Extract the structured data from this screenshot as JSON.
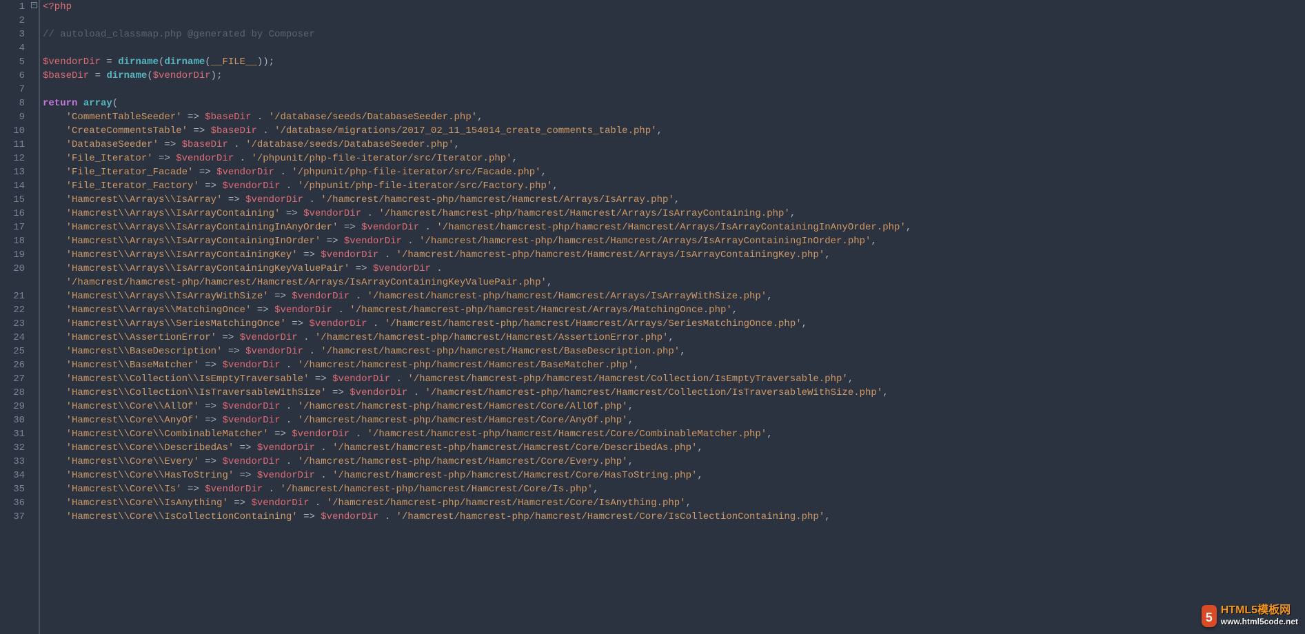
{
  "fold_marker": "−",
  "watermark": {
    "badge": "5",
    "line1": "HTML5模板网",
    "line2": "www.html5code.net"
  },
  "lines": [
    {
      "n": 1,
      "seg": [
        [
          "tag",
          "<?php"
        ]
      ]
    },
    {
      "n": 2,
      "seg": []
    },
    {
      "n": 3,
      "seg": [
        [
          "comment",
          "// autoload_classmap.php @generated by Composer"
        ]
      ]
    },
    {
      "n": 4,
      "seg": []
    },
    {
      "n": 5,
      "seg": [
        [
          "var",
          "$vendorDir"
        ],
        [
          "op",
          " = "
        ],
        [
          "func",
          "dirname"
        ],
        [
          "punct",
          "("
        ],
        [
          "func",
          "dirname"
        ],
        [
          "punct",
          "("
        ],
        [
          "const",
          "__FILE__"
        ],
        [
          "punct",
          "));"
        ]
      ]
    },
    {
      "n": 6,
      "seg": [
        [
          "var",
          "$baseDir"
        ],
        [
          "op",
          " = "
        ],
        [
          "func",
          "dirname"
        ],
        [
          "punct",
          "("
        ],
        [
          "var",
          "$vendorDir"
        ],
        [
          "punct",
          ");"
        ]
      ]
    },
    {
      "n": 7,
      "seg": []
    },
    {
      "n": 8,
      "seg": [
        [
          "kw",
          "return"
        ],
        [
          "op",
          " "
        ],
        [
          "func",
          "array"
        ],
        [
          "punct",
          "("
        ]
      ]
    },
    {
      "n": 9,
      "seg": [
        [
          "punct",
          "    "
        ],
        [
          "str",
          "'CommentTableSeeder'"
        ],
        [
          "op",
          " => "
        ],
        [
          "var",
          "$baseDir"
        ],
        [
          "op",
          " . "
        ],
        [
          "str",
          "'/database/seeds/DatabaseSeeder.php'"
        ],
        [
          "punct",
          ","
        ]
      ]
    },
    {
      "n": 10,
      "seg": [
        [
          "punct",
          "    "
        ],
        [
          "str",
          "'CreateCommentsTable'"
        ],
        [
          "op",
          " => "
        ],
        [
          "var",
          "$baseDir"
        ],
        [
          "op",
          " . "
        ],
        [
          "str",
          "'/database/migrations/2017_02_11_154014_create_comments_table.php'"
        ],
        [
          "punct",
          ","
        ]
      ]
    },
    {
      "n": 11,
      "seg": [
        [
          "punct",
          "    "
        ],
        [
          "str",
          "'DatabaseSeeder'"
        ],
        [
          "op",
          " => "
        ],
        [
          "var",
          "$baseDir"
        ],
        [
          "op",
          " . "
        ],
        [
          "str",
          "'/database/seeds/DatabaseSeeder.php'"
        ],
        [
          "punct",
          ","
        ]
      ]
    },
    {
      "n": 12,
      "seg": [
        [
          "punct",
          "    "
        ],
        [
          "str",
          "'File_Iterator'"
        ],
        [
          "op",
          " => "
        ],
        [
          "var",
          "$vendorDir"
        ],
        [
          "op",
          " . "
        ],
        [
          "str",
          "'/phpunit/php-file-iterator/src/Iterator.php'"
        ],
        [
          "punct",
          ","
        ]
      ]
    },
    {
      "n": 13,
      "seg": [
        [
          "punct",
          "    "
        ],
        [
          "str",
          "'File_Iterator_Facade'"
        ],
        [
          "op",
          " => "
        ],
        [
          "var",
          "$vendorDir"
        ],
        [
          "op",
          " . "
        ],
        [
          "str",
          "'/phpunit/php-file-iterator/src/Facade.php'"
        ],
        [
          "punct",
          ","
        ]
      ]
    },
    {
      "n": 14,
      "seg": [
        [
          "punct",
          "    "
        ],
        [
          "str",
          "'File_Iterator_Factory'"
        ],
        [
          "op",
          " => "
        ],
        [
          "var",
          "$vendorDir"
        ],
        [
          "op",
          " . "
        ],
        [
          "str",
          "'/phpunit/php-file-iterator/src/Factory.php'"
        ],
        [
          "punct",
          ","
        ]
      ]
    },
    {
      "n": 15,
      "seg": [
        [
          "punct",
          "    "
        ],
        [
          "str",
          "'Hamcrest\\\\Arrays\\\\IsArray'"
        ],
        [
          "op",
          " => "
        ],
        [
          "var",
          "$vendorDir"
        ],
        [
          "op",
          " . "
        ],
        [
          "str",
          "'/hamcrest/hamcrest-php/hamcrest/Hamcrest/Arrays/IsArray.php'"
        ],
        [
          "punct",
          ","
        ]
      ]
    },
    {
      "n": 16,
      "seg": [
        [
          "punct",
          "    "
        ],
        [
          "str",
          "'Hamcrest\\\\Arrays\\\\IsArrayContaining'"
        ],
        [
          "op",
          " => "
        ],
        [
          "var",
          "$vendorDir"
        ],
        [
          "op",
          " . "
        ],
        [
          "str",
          "'/hamcrest/hamcrest-php/hamcrest/Hamcrest/Arrays/IsArrayContaining.php'"
        ],
        [
          "punct",
          ","
        ]
      ]
    },
    {
      "n": 17,
      "seg": [
        [
          "punct",
          "    "
        ],
        [
          "str",
          "'Hamcrest\\\\Arrays\\\\IsArrayContainingInAnyOrder'"
        ],
        [
          "op",
          " => "
        ],
        [
          "var",
          "$vendorDir"
        ],
        [
          "op",
          " . "
        ],
        [
          "str",
          "'/hamcrest/hamcrest-php/hamcrest/Hamcrest/Arrays/IsArrayContainingInAnyOrder.php'"
        ],
        [
          "punct",
          ","
        ]
      ]
    },
    {
      "n": 18,
      "seg": [
        [
          "punct",
          "    "
        ],
        [
          "str",
          "'Hamcrest\\\\Arrays\\\\IsArrayContainingInOrder'"
        ],
        [
          "op",
          " => "
        ],
        [
          "var",
          "$vendorDir"
        ],
        [
          "op",
          " . "
        ],
        [
          "str",
          "'/hamcrest/hamcrest-php/hamcrest/Hamcrest/Arrays/IsArrayContainingInOrder.php'"
        ],
        [
          "punct",
          ","
        ]
      ]
    },
    {
      "n": 19,
      "seg": [
        [
          "punct",
          "    "
        ],
        [
          "str",
          "'Hamcrest\\\\Arrays\\\\IsArrayContainingKey'"
        ],
        [
          "op",
          " => "
        ],
        [
          "var",
          "$vendorDir"
        ],
        [
          "op",
          " . "
        ],
        [
          "str",
          "'/hamcrest/hamcrest-php/hamcrest/Hamcrest/Arrays/IsArrayContainingKey.php'"
        ],
        [
          "punct",
          ","
        ]
      ]
    },
    {
      "n": 20,
      "seg": [
        [
          "punct",
          "    "
        ],
        [
          "str",
          "'Hamcrest\\\\Arrays\\\\IsArrayContainingKeyValuePair'"
        ],
        [
          "op",
          " => "
        ],
        [
          "var",
          "$vendorDir"
        ],
        [
          "op",
          " . "
        ]
      ]
    },
    {
      "n": "",
      "seg": [
        [
          "punct",
          "    "
        ],
        [
          "str",
          "'/hamcrest/hamcrest-php/hamcrest/Hamcrest/Arrays/IsArrayContainingKeyValuePair.php'"
        ],
        [
          "punct",
          ","
        ]
      ]
    },
    {
      "n": 21,
      "seg": [
        [
          "punct",
          "    "
        ],
        [
          "str",
          "'Hamcrest\\\\Arrays\\\\IsArrayWithSize'"
        ],
        [
          "op",
          " => "
        ],
        [
          "var",
          "$vendorDir"
        ],
        [
          "op",
          " . "
        ],
        [
          "str",
          "'/hamcrest/hamcrest-php/hamcrest/Hamcrest/Arrays/IsArrayWithSize.php'"
        ],
        [
          "punct",
          ","
        ]
      ]
    },
    {
      "n": 22,
      "seg": [
        [
          "punct",
          "    "
        ],
        [
          "str",
          "'Hamcrest\\\\Arrays\\\\MatchingOnce'"
        ],
        [
          "op",
          " => "
        ],
        [
          "var",
          "$vendorDir"
        ],
        [
          "op",
          " . "
        ],
        [
          "str",
          "'/hamcrest/hamcrest-php/hamcrest/Hamcrest/Arrays/MatchingOnce.php'"
        ],
        [
          "punct",
          ","
        ]
      ]
    },
    {
      "n": 23,
      "seg": [
        [
          "punct",
          "    "
        ],
        [
          "str",
          "'Hamcrest\\\\Arrays\\\\SeriesMatchingOnce'"
        ],
        [
          "op",
          " => "
        ],
        [
          "var",
          "$vendorDir"
        ],
        [
          "op",
          " . "
        ],
        [
          "str",
          "'/hamcrest/hamcrest-php/hamcrest/Hamcrest/Arrays/SeriesMatchingOnce.php'"
        ],
        [
          "punct",
          ","
        ]
      ]
    },
    {
      "n": 24,
      "seg": [
        [
          "punct",
          "    "
        ],
        [
          "str",
          "'Hamcrest\\\\AssertionError'"
        ],
        [
          "op",
          " => "
        ],
        [
          "var",
          "$vendorDir"
        ],
        [
          "op",
          " . "
        ],
        [
          "str",
          "'/hamcrest/hamcrest-php/hamcrest/Hamcrest/AssertionError.php'"
        ],
        [
          "punct",
          ","
        ]
      ]
    },
    {
      "n": 25,
      "seg": [
        [
          "punct",
          "    "
        ],
        [
          "str",
          "'Hamcrest\\\\BaseDescription'"
        ],
        [
          "op",
          " => "
        ],
        [
          "var",
          "$vendorDir"
        ],
        [
          "op",
          " . "
        ],
        [
          "str",
          "'/hamcrest/hamcrest-php/hamcrest/Hamcrest/BaseDescription.php'"
        ],
        [
          "punct",
          ","
        ]
      ]
    },
    {
      "n": 26,
      "seg": [
        [
          "punct",
          "    "
        ],
        [
          "str",
          "'Hamcrest\\\\BaseMatcher'"
        ],
        [
          "op",
          " => "
        ],
        [
          "var",
          "$vendorDir"
        ],
        [
          "op",
          " . "
        ],
        [
          "str",
          "'/hamcrest/hamcrest-php/hamcrest/Hamcrest/BaseMatcher.php'"
        ],
        [
          "punct",
          ","
        ]
      ]
    },
    {
      "n": 27,
      "seg": [
        [
          "punct",
          "    "
        ],
        [
          "str",
          "'Hamcrest\\\\Collection\\\\IsEmptyTraversable'"
        ],
        [
          "op",
          " => "
        ],
        [
          "var",
          "$vendorDir"
        ],
        [
          "op",
          " . "
        ],
        [
          "str",
          "'/hamcrest/hamcrest-php/hamcrest/Hamcrest/Collection/IsEmptyTraversable.php'"
        ],
        [
          "punct",
          ","
        ]
      ]
    },
    {
      "n": 28,
      "seg": [
        [
          "punct",
          "    "
        ],
        [
          "str",
          "'Hamcrest\\\\Collection\\\\IsTraversableWithSize'"
        ],
        [
          "op",
          " => "
        ],
        [
          "var",
          "$vendorDir"
        ],
        [
          "op",
          " . "
        ],
        [
          "str",
          "'/hamcrest/hamcrest-php/hamcrest/Hamcrest/Collection/IsTraversableWithSize.php'"
        ],
        [
          "punct",
          ","
        ]
      ]
    },
    {
      "n": 29,
      "seg": [
        [
          "punct",
          "    "
        ],
        [
          "str",
          "'Hamcrest\\\\Core\\\\AllOf'"
        ],
        [
          "op",
          " => "
        ],
        [
          "var",
          "$vendorDir"
        ],
        [
          "op",
          " . "
        ],
        [
          "str",
          "'/hamcrest/hamcrest-php/hamcrest/Hamcrest/Core/AllOf.php'"
        ],
        [
          "punct",
          ","
        ]
      ]
    },
    {
      "n": 30,
      "seg": [
        [
          "punct",
          "    "
        ],
        [
          "str",
          "'Hamcrest\\\\Core\\\\AnyOf'"
        ],
        [
          "op",
          " => "
        ],
        [
          "var",
          "$vendorDir"
        ],
        [
          "op",
          " . "
        ],
        [
          "str",
          "'/hamcrest/hamcrest-php/hamcrest/Hamcrest/Core/AnyOf.php'"
        ],
        [
          "punct",
          ","
        ]
      ]
    },
    {
      "n": 31,
      "seg": [
        [
          "punct",
          "    "
        ],
        [
          "str",
          "'Hamcrest\\\\Core\\\\CombinableMatcher'"
        ],
        [
          "op",
          " => "
        ],
        [
          "var",
          "$vendorDir"
        ],
        [
          "op",
          " . "
        ],
        [
          "str",
          "'/hamcrest/hamcrest-php/hamcrest/Hamcrest/Core/CombinableMatcher.php'"
        ],
        [
          "punct",
          ","
        ]
      ]
    },
    {
      "n": 32,
      "seg": [
        [
          "punct",
          "    "
        ],
        [
          "str",
          "'Hamcrest\\\\Core\\\\DescribedAs'"
        ],
        [
          "op",
          " => "
        ],
        [
          "var",
          "$vendorDir"
        ],
        [
          "op",
          " . "
        ],
        [
          "str",
          "'/hamcrest/hamcrest-php/hamcrest/Hamcrest/Core/DescribedAs.php'"
        ],
        [
          "punct",
          ","
        ]
      ]
    },
    {
      "n": 33,
      "seg": [
        [
          "punct",
          "    "
        ],
        [
          "str",
          "'Hamcrest\\\\Core\\\\Every'"
        ],
        [
          "op",
          " => "
        ],
        [
          "var",
          "$vendorDir"
        ],
        [
          "op",
          " . "
        ],
        [
          "str",
          "'/hamcrest/hamcrest-php/hamcrest/Hamcrest/Core/Every.php'"
        ],
        [
          "punct",
          ","
        ]
      ]
    },
    {
      "n": 34,
      "seg": [
        [
          "punct",
          "    "
        ],
        [
          "str",
          "'Hamcrest\\\\Core\\\\HasToString'"
        ],
        [
          "op",
          " => "
        ],
        [
          "var",
          "$vendorDir"
        ],
        [
          "op",
          " . "
        ],
        [
          "str",
          "'/hamcrest/hamcrest-php/hamcrest/Hamcrest/Core/HasToString.php'"
        ],
        [
          "punct",
          ","
        ]
      ]
    },
    {
      "n": 35,
      "seg": [
        [
          "punct",
          "    "
        ],
        [
          "str",
          "'Hamcrest\\\\Core\\\\Is'"
        ],
        [
          "op",
          " => "
        ],
        [
          "var",
          "$vendorDir"
        ],
        [
          "op",
          " . "
        ],
        [
          "str",
          "'/hamcrest/hamcrest-php/hamcrest/Hamcrest/Core/Is.php'"
        ],
        [
          "punct",
          ","
        ]
      ]
    },
    {
      "n": 36,
      "seg": [
        [
          "punct",
          "    "
        ],
        [
          "str",
          "'Hamcrest\\\\Core\\\\IsAnything'"
        ],
        [
          "op",
          " => "
        ],
        [
          "var",
          "$vendorDir"
        ],
        [
          "op",
          " . "
        ],
        [
          "str",
          "'/hamcrest/hamcrest-php/hamcrest/Hamcrest/Core/IsAnything.php'"
        ],
        [
          "punct",
          ","
        ]
      ]
    },
    {
      "n": 37,
      "seg": [
        [
          "punct",
          "    "
        ],
        [
          "str",
          "'Hamcrest\\\\Core\\\\IsCollectionContaining'"
        ],
        [
          "op",
          " => "
        ],
        [
          "var",
          "$vendorDir"
        ],
        [
          "op",
          " . "
        ],
        [
          "str",
          "'/hamcrest/hamcrest-php/hamcrest/Hamcrest/Core/IsCollectionContaining.php'"
        ],
        [
          "punct",
          ","
        ]
      ]
    }
  ]
}
